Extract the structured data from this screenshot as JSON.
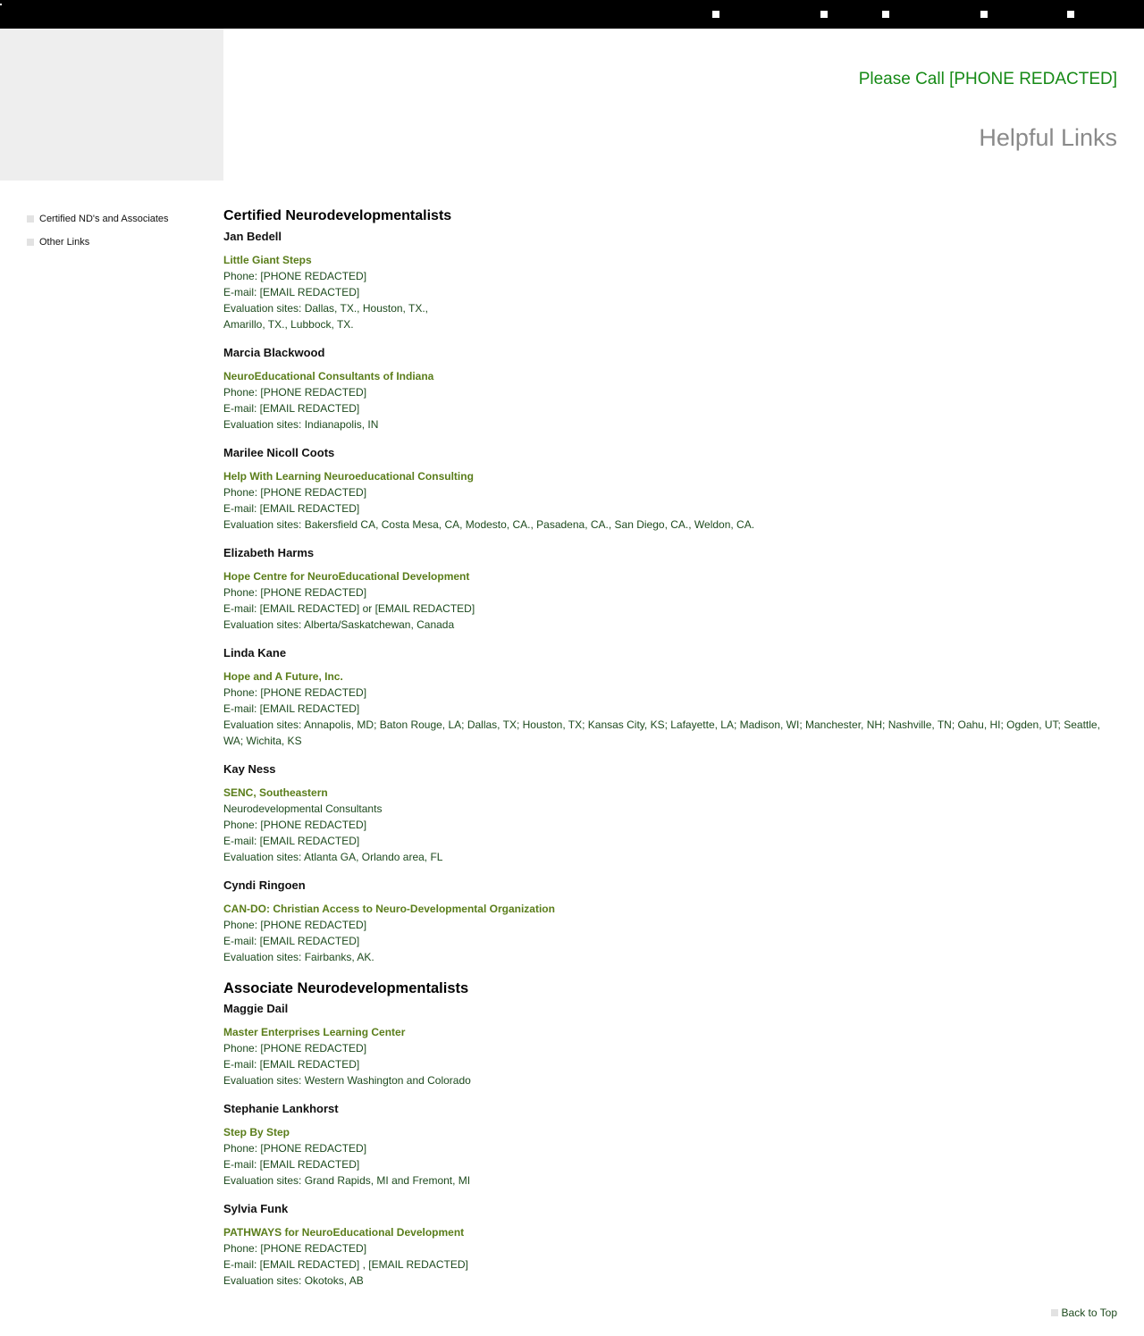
{
  "header": {
    "call_text": "Please Call [PHONE REDACTED]",
    "page_title": "Helpful Links"
  },
  "sidebar": {
    "items": [
      {
        "label": "Certified ND's and Associates"
      },
      {
        "label": "Other Links"
      }
    ]
  },
  "sections": [
    {
      "title": "Certified Neurodevelopmentalists",
      "entries": [
        {
          "name": "Jan Bedell",
          "org": "Little Giant Steps",
          "lines": [
            "Phone: [PHONE REDACTED]",
            "E-mail: [EMAIL REDACTED]",
            "Evaluation sites: Dallas, TX., Houston, TX.,",
            "Amarillo, TX., Lubbock, TX."
          ]
        },
        {
          "name": "Marcia Blackwood",
          "org": "NeuroEducational Consultants of Indiana",
          "lines": [
            "Phone: [PHONE REDACTED]",
            "E-mail: [EMAIL REDACTED]",
            "Evaluation sites: Indianapolis, IN"
          ]
        },
        {
          "name": "Marilee Nicoll Coots",
          "org": "Help With Learning Neuroeducational Consulting",
          "lines": [
            "Phone: [PHONE REDACTED]",
            "E-mail: [EMAIL REDACTED]",
            "Evaluation sites: Bakersfield CA, Costa Mesa, CA, Modesto, CA., Pasadena, CA., San Diego, CA., Weldon, CA."
          ]
        },
        {
          "name": "Elizabeth Harms",
          "org": "Hope Centre for NeuroEducational Development",
          "lines": [
            "Phone: [PHONE REDACTED]",
            "E-mail: [EMAIL REDACTED] or [EMAIL REDACTED]",
            "Evaluation sites: Alberta/Saskatchewan, Canada"
          ]
        },
        {
          "name": "Linda Kane",
          "org": "Hope and A Future, Inc.",
          "lines": [
            "Phone: [PHONE REDACTED]",
            "E-mail: [EMAIL REDACTED]",
            "Evaluation sites: Annapolis, MD; Baton Rouge, LA; Dallas, TX; Houston, TX; Kansas City, KS; Lafayette, LA; Madison, WI; Manchester, NH; Nashville, TN; Oahu, HI; Ogden, UT; Seattle, WA; Wichita, KS"
          ]
        },
        {
          "name": "Kay Ness",
          "org": "SENC, Southeastern",
          "lines": [
            "Neurodevelopmental Consultants",
            "Phone: [PHONE REDACTED]",
            "E-mail: [EMAIL REDACTED]",
            "Evaluation sites: Atlanta GA, Orlando area, FL"
          ]
        },
        {
          "name": "Cyndi Ringoen",
          "org": "CAN-DO: Christian Access to Neuro-Developmental Organization",
          "lines": [
            "Phone: [PHONE REDACTED]",
            "E-mail: [EMAIL REDACTED]",
            "Evaluation sites: Fairbanks, AK."
          ]
        }
      ]
    },
    {
      "title": "Associate Neurodevelopmentalists",
      "entries": [
        {
          "name": "Maggie Dail",
          "org": "Master Enterprises Learning Center",
          "lines": [
            "Phone: [PHONE REDACTED]",
            "E-mail: [EMAIL REDACTED]",
            "Evaluation sites: Western Washington and Colorado"
          ]
        },
        {
          "name": "Stephanie Lankhorst",
          "org": "Step By Step",
          "lines": [
            "Phone: [PHONE REDACTED]",
            "E-mail: [EMAIL REDACTED]",
            "Evaluation sites: Grand Rapids, MI and Fremont, MI"
          ]
        },
        {
          "name": "Sylvia Funk",
          "org": "PATHWAYS for NeuroEducational Development",
          "lines": [
            "Phone: [PHONE REDACTED]",
            "E-mail: [EMAIL REDACTED] , [EMAIL REDACTED]",
            "Evaluation sites: Okotoks, AB"
          ]
        }
      ]
    }
  ],
  "footer": {
    "back_to_top": "Back to Top"
  },
  "colors": {
    "topbar": "#000000",
    "call_text": "#168a16",
    "title": "#8a8a8a",
    "org_link": "#5a7d1a",
    "body_text": "#1d4a1d"
  }
}
